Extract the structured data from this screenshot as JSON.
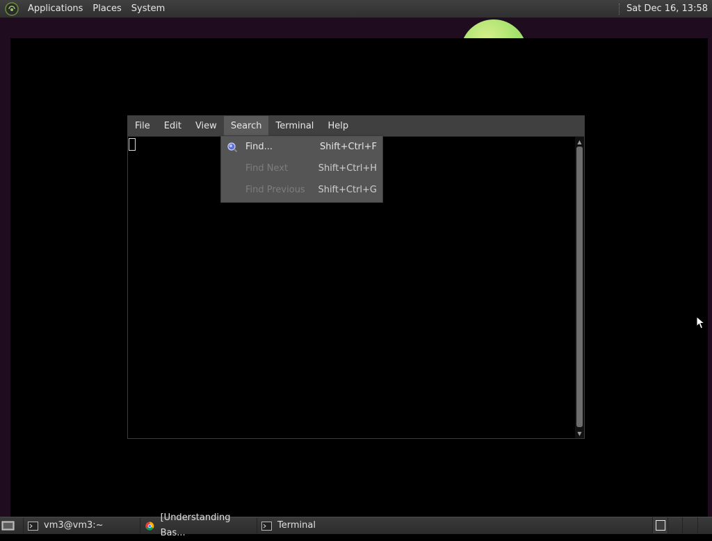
{
  "top_panel": {
    "menus": [
      "Applications",
      "Places",
      "System"
    ],
    "clock": "Sat Dec 16, 13:58"
  },
  "terminal": {
    "menubar": [
      "File",
      "Edit",
      "View",
      "Search",
      "Terminal",
      "Help"
    ],
    "active_menu": "Search"
  },
  "search_menu": {
    "items": [
      {
        "label": "Find...",
        "shortcut": "Shift+Ctrl+F",
        "icon": "find-icon",
        "enabled": true
      },
      {
        "label": "Find Next",
        "shortcut": "Shift+Ctrl+H",
        "enabled": false
      },
      {
        "label": "Find Previous",
        "shortcut": "Shift+Ctrl+G",
        "enabled": false
      }
    ]
  },
  "taskbar": {
    "tasks": [
      {
        "label": "vm3@vm3:~",
        "icon": "terminal-icon"
      },
      {
        "label": "[Understanding Bas...",
        "icon": "chrome-icon"
      },
      {
        "label": "Terminal",
        "icon": "terminal-icon"
      }
    ]
  }
}
